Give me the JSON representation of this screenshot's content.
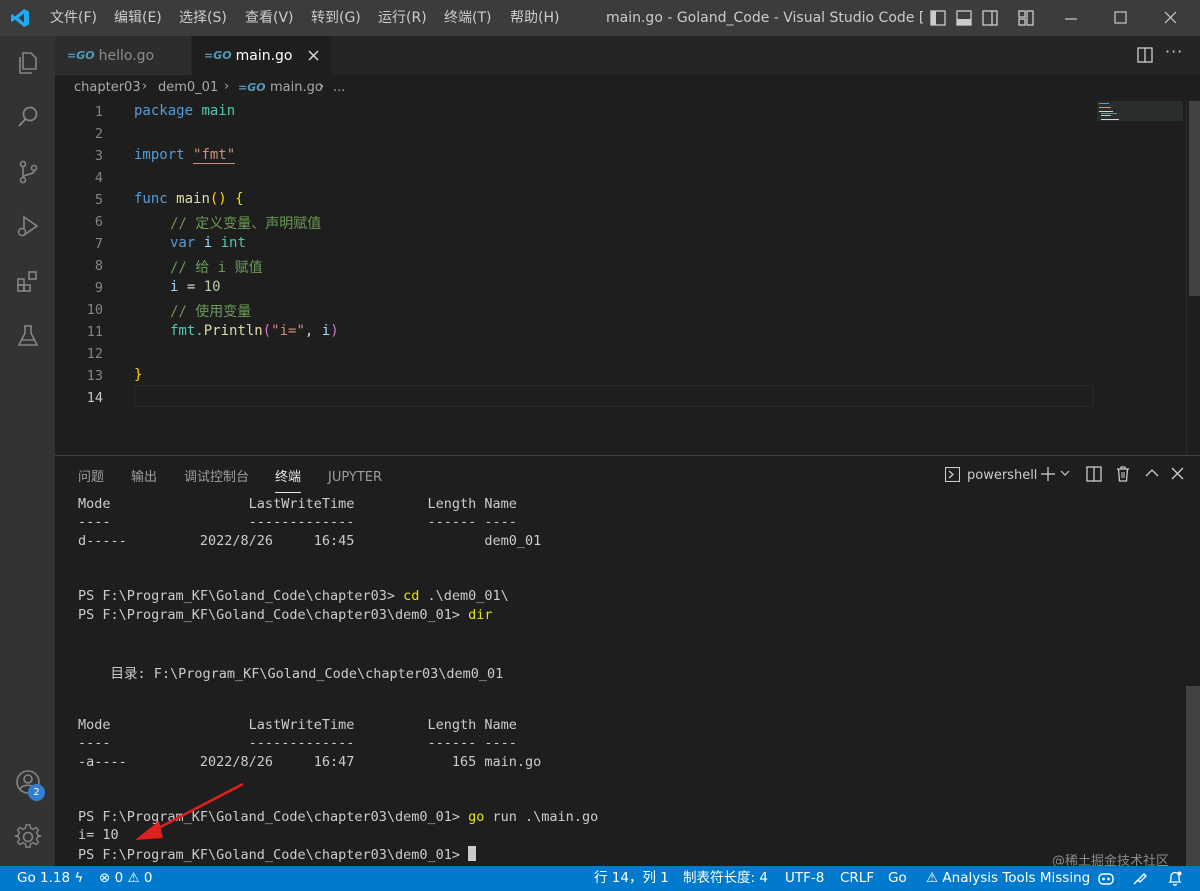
{
  "titlebar": {
    "menus": [
      "文件(F)",
      "编辑(E)",
      "选择(S)",
      "查看(V)",
      "转到(G)",
      "运行(R)",
      "终端(T)",
      "帮助(H)"
    ],
    "title": "main.go - Goland_Code - Visual Studio Code [管理员]"
  },
  "activity": {
    "accounts_badge": "2"
  },
  "tabs": [
    {
      "label": "hello.go"
    },
    {
      "label": "main.go"
    }
  ],
  "breadcrumb": {
    "folder1": "chapter03",
    "folder2": "dem0_01",
    "file": "main.go",
    "more": "..."
  },
  "editor": {
    "line_numbers": [
      "1",
      "2",
      "3",
      "4",
      "5",
      "6",
      "7",
      "8",
      "9",
      "10",
      "11",
      "12",
      "13",
      "14"
    ],
    "code": {
      "package_kw": "package",
      "package_name": "main",
      "import_kw": "import",
      "import_path": "\"fmt\"",
      "func_kw": "func",
      "func_name": "main",
      "func_open": "()",
      "brace_open": "{",
      "comment1": "// 定义变量、声明赋值",
      "var_kw": "var",
      "var_name": "i",
      "var_type": "int",
      "comment2": "// 给 i 赋值",
      "assign_var": "i",
      "assign_op": "=",
      "assign_val": "10",
      "comment3": "// 使用变量",
      "call_pkg": "fmt.",
      "call_fn": "Println",
      "call_open": "(",
      "call_str": "\"i=\"",
      "call_sep": ", ",
      "call_arg": "i",
      "call_close": ")",
      "brace_close": "}"
    }
  },
  "panel": {
    "tabs": [
      "问题",
      "输出",
      "调试控制台",
      "终端",
      "JUPYTER"
    ],
    "shell": "powershell",
    "terminal": {
      "l1": "Mode                 LastWriteTime         Length Name",
      "l2": "----                 -------------         ------ ----",
      "l3": "d-----         2022/8/26     16:45                dem0_01",
      "l4_prompt": "PS F:\\Program_KF\\Goland_Code\\chapter03> ",
      "l4_cmd": "cd",
      "l4_arg": " .\\dem0_01\\",
      "l5_prompt": "PS F:\\Program_KF\\Goland_Code\\chapter03\\dem0_01> ",
      "l5_cmd": "dir",
      "l6": "    目录: F:\\Program_KF\\Goland_Code\\chapter03\\dem0_01",
      "l7": "Mode                 LastWriteTime         Length Name",
      "l8": "----                 -------------         ------ ----",
      "l9": "-a----         2022/8/26     16:47            165 main.go",
      "l10_prompt": "PS F:\\Program_KF\\Goland_Code\\chapter03\\dem0_01> ",
      "l10_cmd": "go",
      "l10_arg": " run .\\main.go",
      "l11": "i= 10",
      "l12_prompt": "PS F:\\Program_KF\\Goland_Code\\chapter03\\dem0_01> "
    }
  },
  "statusbar": {
    "go_version": "Go 1.18",
    "errors": "0",
    "warnings": "0",
    "position": "行 14，列 1",
    "tab_size": "制表符长度: 4",
    "encoding": "UTF-8",
    "eol": "CRLF",
    "language": "Go",
    "analysis": "Analysis Tools Missing"
  },
  "watermark": "@稀土掘金技术社区"
}
